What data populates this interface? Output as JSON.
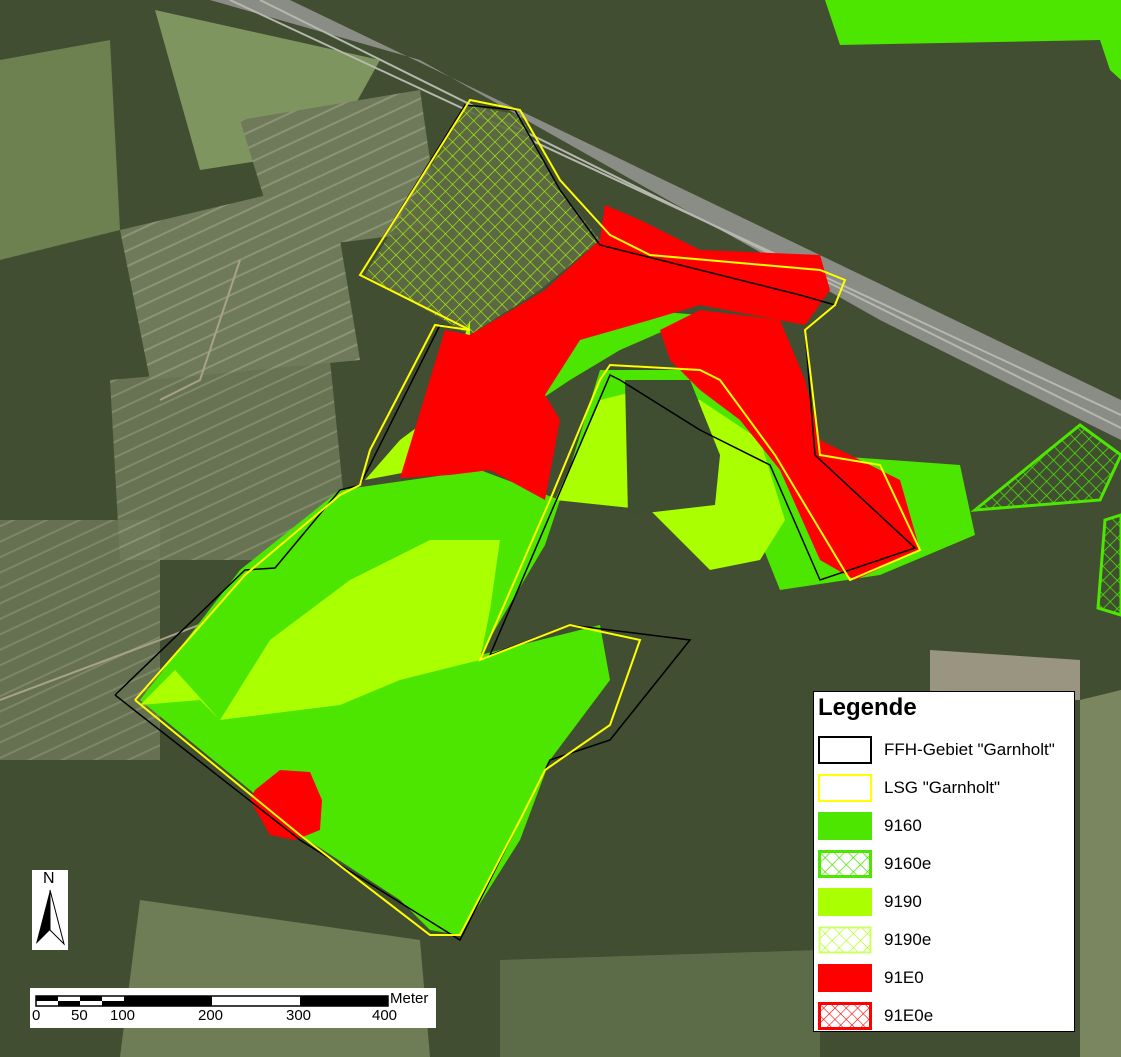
{
  "legend": {
    "title": "Legende",
    "items": [
      {
        "label": "FFH-Gebiet \"Garnholt\"",
        "fill": "#ffffff",
        "stroke": "#000000",
        "pattern": "none"
      },
      {
        "label": "LSG \"Garnholt\"",
        "fill": "#ffffff",
        "stroke": "#ffff00",
        "pattern": "none"
      },
      {
        "label": "9160",
        "fill": "#4ce600",
        "stroke": "none",
        "pattern": "solid"
      },
      {
        "label": "9160e",
        "fill": "#4ce600",
        "stroke": "#4ce600",
        "pattern": "hatch"
      },
      {
        "label": "9190",
        "fill": "#aaff00",
        "stroke": "none",
        "pattern": "solid"
      },
      {
        "label": "9190e",
        "fill": "#aaff00",
        "stroke": "#aaff00",
        "pattern": "hatch"
      },
      {
        "label": "91E0",
        "fill": "#ff0000",
        "stroke": "none",
        "pattern": "solid"
      },
      {
        "label": "91E0e",
        "fill": "#ff0000",
        "stroke": "#ff0000",
        "pattern": "hatch"
      }
    ]
  },
  "scalebar": {
    "unit": "Meter",
    "ticks": [
      "0",
      "50",
      "100",
      "200",
      "300",
      "400"
    ]
  },
  "north_arrow": {
    "label": "N"
  },
  "colors": {
    "ffh_boundary": "#000000",
    "lsg_boundary": "#ffff00",
    "habitat_9160": "#4ce600",
    "habitat_9190": "#aaff00",
    "habitat_91E0": "#ff0000",
    "imagery_base": "#3d4a2e"
  }
}
